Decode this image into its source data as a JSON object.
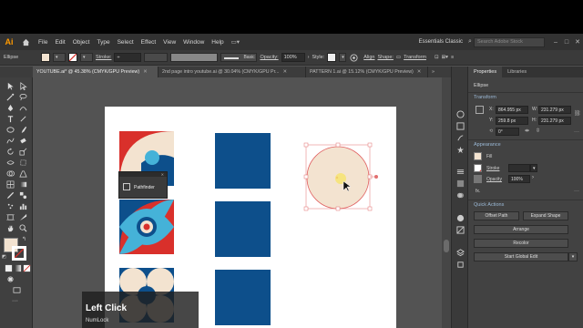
{
  "menubar": {
    "logo": "Ai",
    "items": [
      "File",
      "Edit",
      "Object",
      "Type",
      "Select",
      "Effect",
      "View",
      "Window",
      "Help"
    ],
    "workspace": "Essentials Classic",
    "stock_search_placeholder": "Search Adobe Stock"
  },
  "controlbar": {
    "object_type": "Ellipse",
    "stroke_label": "Stroke:",
    "brush_label": "Basic",
    "opacity_label": "Opacity:",
    "opacity_value": "100%",
    "style_label": "Style:",
    "align_label": "Align",
    "shape_label": "Shape:",
    "transform_label": "Transform",
    "fill_color": "#f3e3d0",
    "stroke_color": "#ffffff"
  },
  "tabs": [
    {
      "label": "YOUTUBE.ai* @ 45.38% (CMYK/GPU Preview)",
      "active": true
    },
    {
      "label": "2nd page intro youtube.ai @ 30.04% (CMYK/GPU Pr...",
      "active": false
    },
    {
      "label": "PATTERN 1.ai @ 15.12% (CMYK/GPU Preview)",
      "active": false
    }
  ],
  "pathfinder": {
    "label": "Pathfinder"
  },
  "properties": {
    "tabs": [
      "Properties",
      "Libraries"
    ],
    "object": "Ellipse",
    "transform_title": "Transform",
    "x_label": "X:",
    "x_value": "864.955 px",
    "y_label": "Y:",
    "y_value": "259.8 px",
    "w_label": "W:",
    "w_value": "231.279 px",
    "h_label": "H:",
    "h_value": "231.279 px",
    "angle_value": "0°",
    "appearance_title": "Appearance",
    "fill_label": "Fill",
    "stroke_label": "Stroke",
    "opacity_label": "Opacity",
    "opacity_value": "100%",
    "fx_label": "fx.",
    "quick_actions_title": "Quick Actions",
    "offset_path": "Offset Path",
    "expand_shape": "Expand Shape",
    "arrange": "Arrange",
    "recolor": "Recolor",
    "start_global_edit": "Start Global Edit"
  },
  "overlay": {
    "main": "Left Click",
    "sub": "NumLock"
  },
  "colors": {
    "navy": "#0d4f8b",
    "red": "#d9302b",
    "cyan": "#45b2d8",
    "cream": "#f3e3d0",
    "dark": "#1b2a3b"
  }
}
